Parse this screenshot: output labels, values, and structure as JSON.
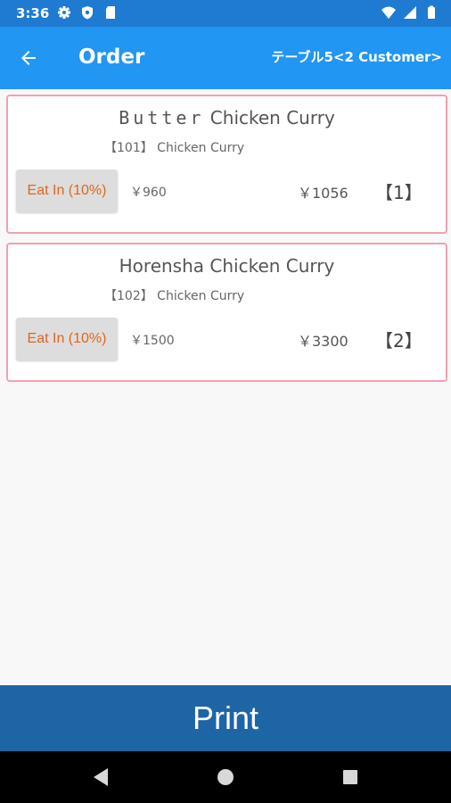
{
  "status_bar": {
    "time": "3:36",
    "left_icons": [
      "gear-icon",
      "shield-icon",
      "sd-card-icon"
    ],
    "right_icons": [
      "wifi-icon",
      "signal-icon",
      "battery-icon"
    ]
  },
  "app_bar": {
    "title": "Order",
    "table_info": "テーブル5<2 Customer>",
    "back_icon": "arrow-left-icon"
  },
  "orders": [
    {
      "name_prefix": "Butter",
      "name_suffix": " Chicken Curry",
      "code": "【101】 Chicken Curry",
      "tax_label": "Eat In (10%)",
      "unit_price": "￥960",
      "total": "￥1056",
      "quantity": "【1】"
    },
    {
      "name_prefix": "",
      "name_suffix": "Horensha Chicken Curry",
      "code": "【102】 Chicken Curry",
      "tax_label": "Eat In (10%)",
      "unit_price": "￥1500",
      "total": "￥3300",
      "quantity": "【2】"
    }
  ],
  "print_label": "Print",
  "colors": {
    "status_bar": "#1e7bd1",
    "app_bar": "#2196f3",
    "card_border": "#f2a0b0",
    "tax_text": "#e0661f",
    "print_button": "#1e65a6"
  }
}
